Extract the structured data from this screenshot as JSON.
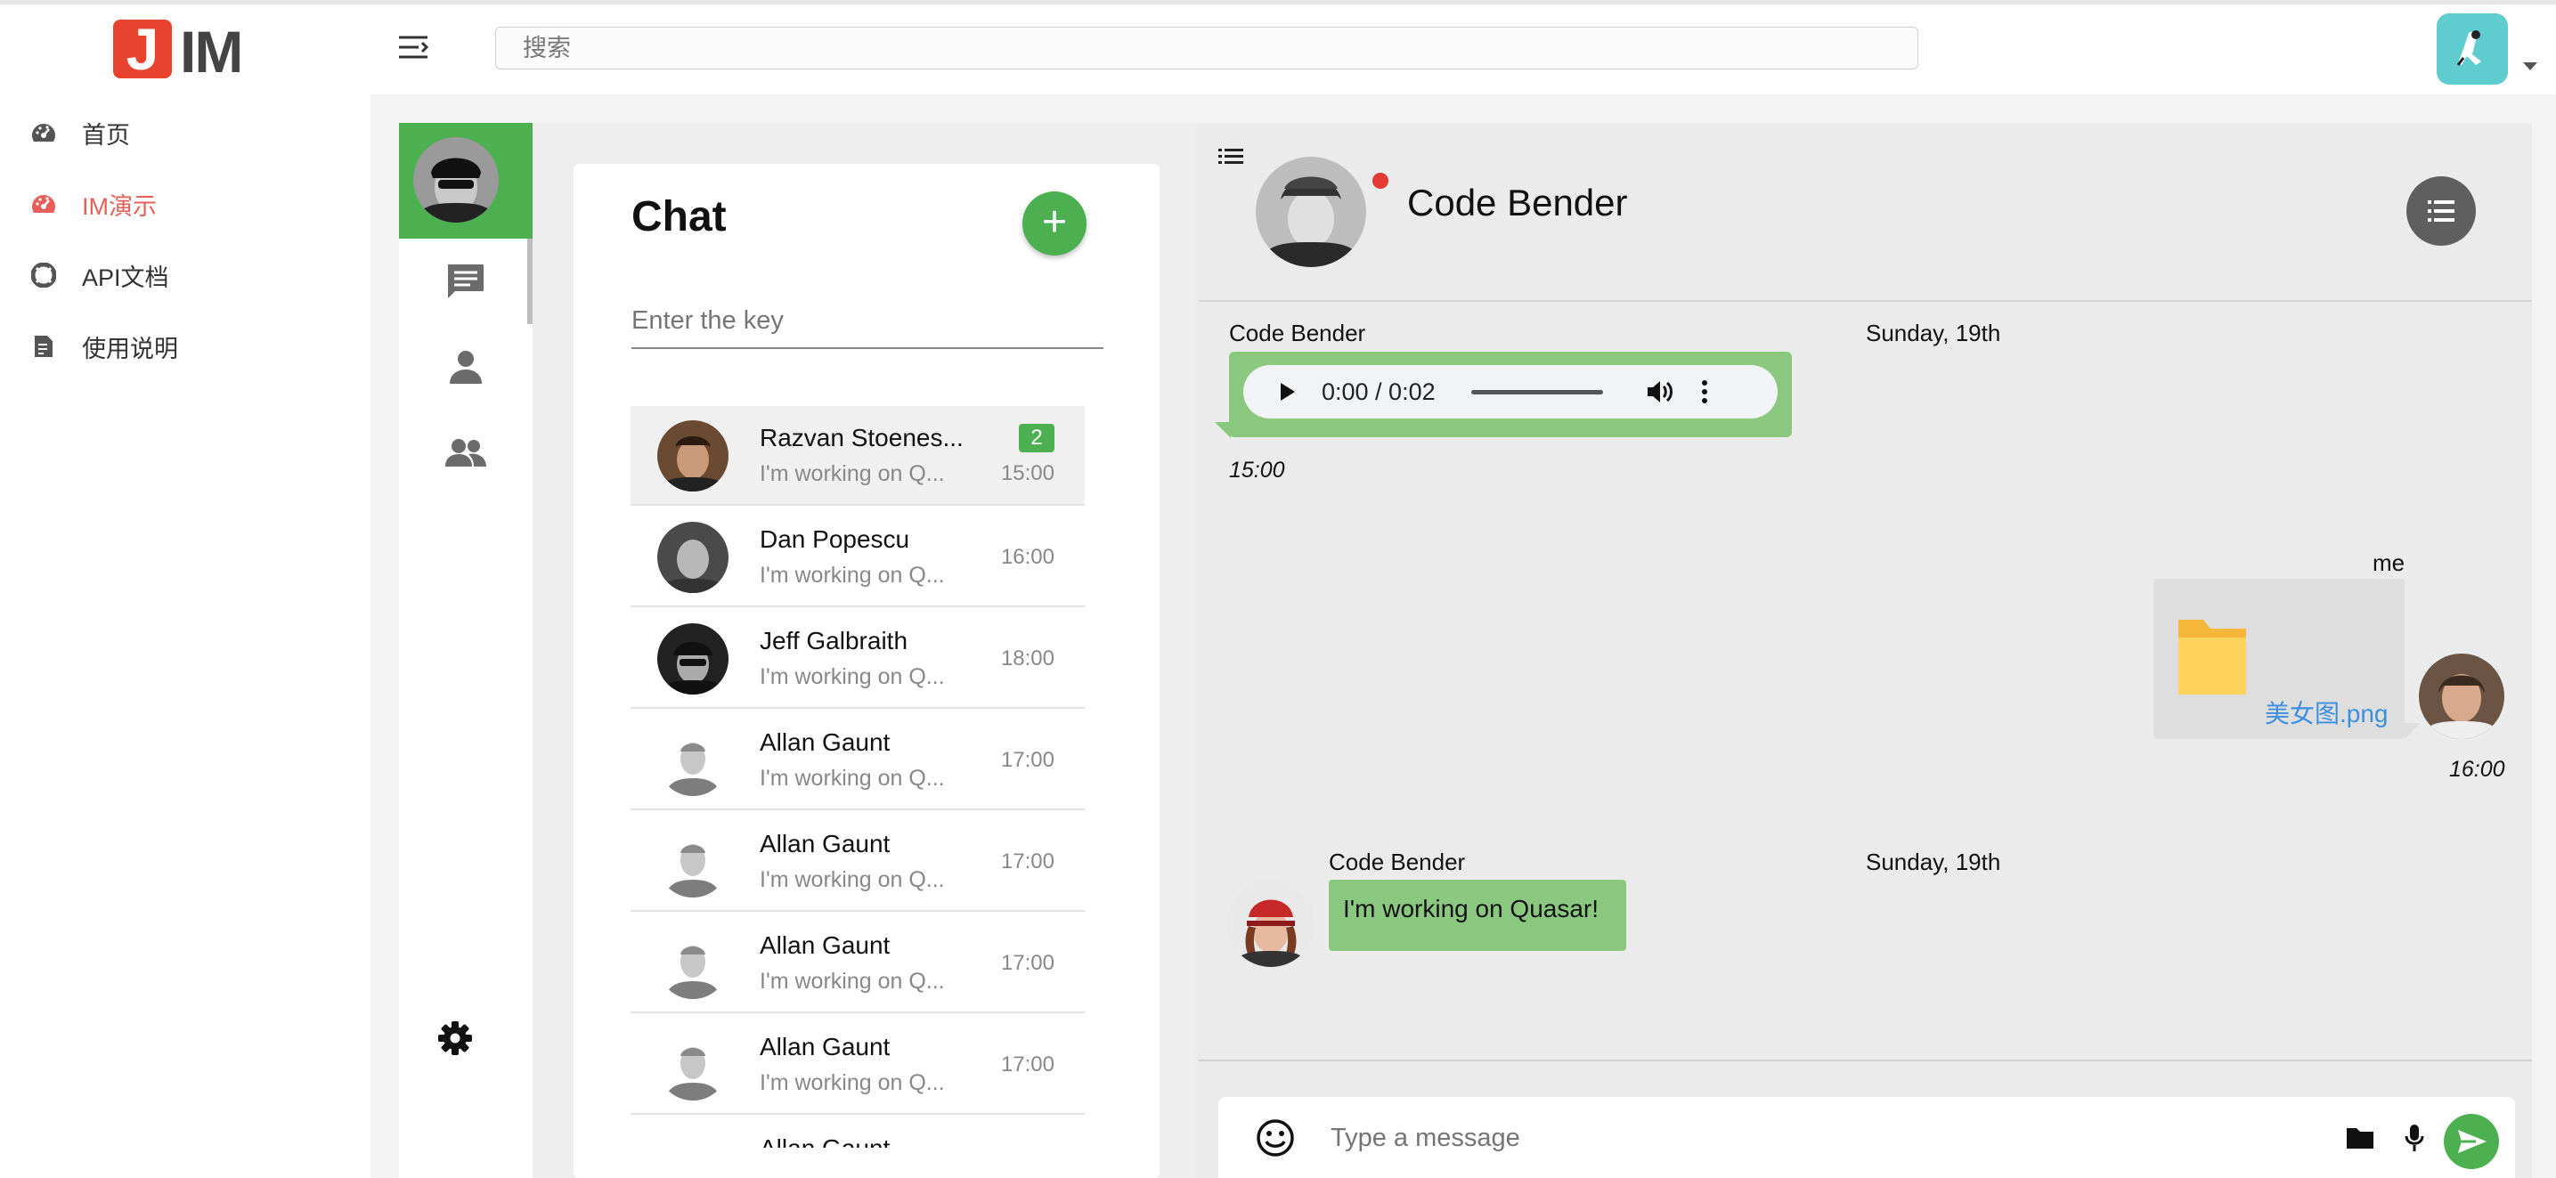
{
  "app": {
    "logo_letter": "J",
    "logo_text": "IM",
    "search_placeholder": "搜索"
  },
  "sidebar": {
    "items": [
      {
        "label": "首页",
        "icon": "dashboard-icon"
      },
      {
        "label": "IM演示",
        "icon": "dashboard-icon",
        "active": true
      },
      {
        "label": "API文档",
        "icon": "lifebuoy-icon"
      },
      {
        "label": "使用说明",
        "icon": "document-icon"
      }
    ]
  },
  "colors": {
    "accent": "#4caf50",
    "active_nav": "#e85f59",
    "logo_red": "#e8432e",
    "link": "#3b8fe0"
  },
  "chat_panel": {
    "title": "Chat",
    "add_label": "+",
    "search_placeholder": "Enter the key",
    "contacts": [
      {
        "name": "Razvan Stoenes...",
        "preview": "I'm working on Q...",
        "time": "15:00",
        "badge": "2"
      },
      {
        "name": "Dan Popescu",
        "preview": "I'm working on Q...",
        "time": "16:00"
      },
      {
        "name": "Jeff Galbraith",
        "preview": "I'm working on Q...",
        "time": "18:00"
      },
      {
        "name": "Allan Gaunt",
        "preview": "I'm working on Q...",
        "time": "17:00"
      },
      {
        "name": "Allan Gaunt",
        "preview": "I'm working on Q...",
        "time": "17:00"
      },
      {
        "name": "Allan Gaunt",
        "preview": "I'm working on Q...",
        "time": "17:00"
      },
      {
        "name": "Allan Gaunt",
        "preview": "I'm working on Q...",
        "time": "17:00"
      },
      {
        "name": "Allan Gaunt"
      }
    ]
  },
  "conversation": {
    "title": "Code Bender",
    "messages": [
      {
        "sender": "Code Bender",
        "date": "Sunday, 19th",
        "audio_time": "0:00 / 0:02",
        "time": "15:00"
      },
      {
        "sender": "me",
        "file_name": "美女图.png",
        "time": "16:00"
      },
      {
        "sender": "Code Bender",
        "date": "Sunday, 19th",
        "text": "I'm working on Quasar!"
      }
    ],
    "composer_placeholder": "Type a message"
  }
}
